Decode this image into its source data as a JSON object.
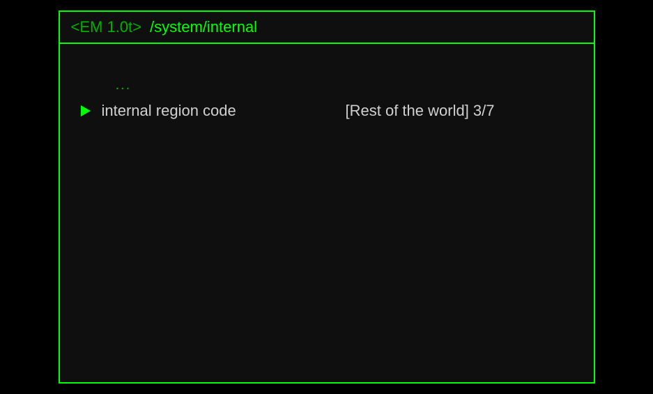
{
  "header": {
    "prefix": "<EM 1.0t>",
    "path": "/system/internal"
  },
  "menu": {
    "parent_indicator": "...",
    "items": [
      {
        "label": "internal region code",
        "value_text": "[Rest of the world] 3/7",
        "selected": true
      }
    ]
  }
}
